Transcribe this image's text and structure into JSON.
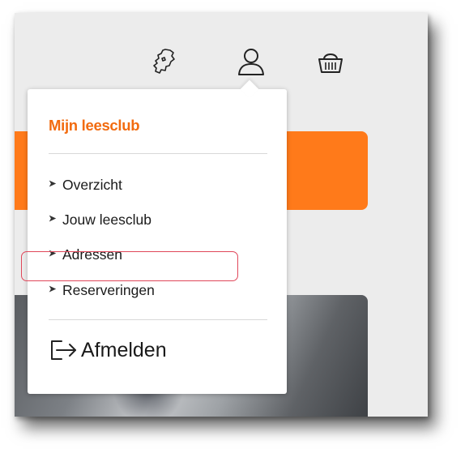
{
  "header": {
    "icons": [
      "netherlands-map-icon",
      "user-account-icon",
      "shopping-basket-icon"
    ]
  },
  "dropdown": {
    "title": "Mijn leesclub",
    "items": [
      {
        "label": "Overzicht",
        "icon": "chevron-right-icon"
      },
      {
        "label": "Jouw leesclub",
        "icon": "chevron-right-icon"
      },
      {
        "label": "Adressen",
        "icon": "chevron-right-icon",
        "highlighted": true
      },
      {
        "label": "Reserveringen",
        "icon": "chevron-right-icon"
      }
    ],
    "logout_label": "Afmelden",
    "logout_icon": "logout-arrow-icon"
  },
  "colors": {
    "accent": "#f26b0f",
    "banner": "#ff7a1a",
    "highlight_border": "#e0475a",
    "page_background": "#ececec"
  }
}
